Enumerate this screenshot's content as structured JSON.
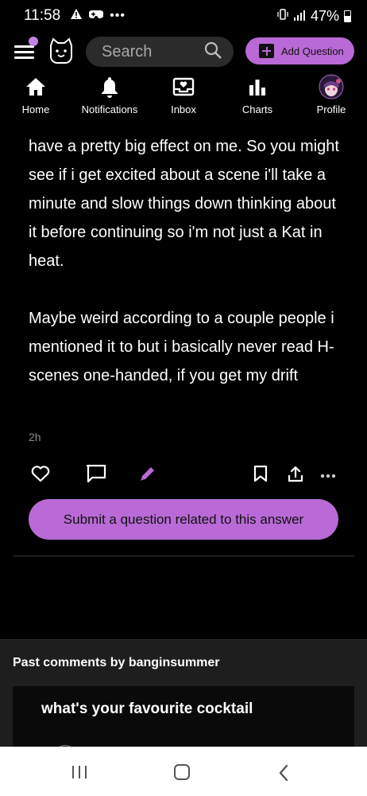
{
  "status_bar": {
    "time": "11:58",
    "battery": "47%",
    "battery_level": 0.47
  },
  "header": {
    "search_placeholder": "Search",
    "add_question_label": "Add Question",
    "accent_color": "#b96ad6"
  },
  "nav": {
    "items": [
      {
        "label": "Home",
        "icon": "home-icon"
      },
      {
        "label": "Notifications",
        "icon": "bell-icon"
      },
      {
        "label": "Inbox",
        "icon": "inbox-icon"
      },
      {
        "label": "Charts",
        "icon": "bar-chart-icon"
      },
      {
        "label": "Profile",
        "icon": "profile-avatar"
      }
    ]
  },
  "answer": {
    "paragraph1": "have a pretty big effect on me.  So you might see if i get excited about a scene i'll take a minute and slow things down thinking about it before continuing so i'm not just a Kat in heat.",
    "paragraph2": "Maybe weird according to a couple people i mentioned it to but i basically never read H-scenes one-handed, if you get my drift",
    "timestamp": "2h"
  },
  "actions": {
    "icons": [
      "heart-icon",
      "comment-icon",
      "edit-icon",
      "bookmark-icon",
      "share-icon",
      "more-icon"
    ]
  },
  "submit_button_label": "Submit a question related to this answer",
  "past_comments": {
    "title": "Past comments by banginsummer",
    "first_question": "what's your favourite cocktail"
  }
}
